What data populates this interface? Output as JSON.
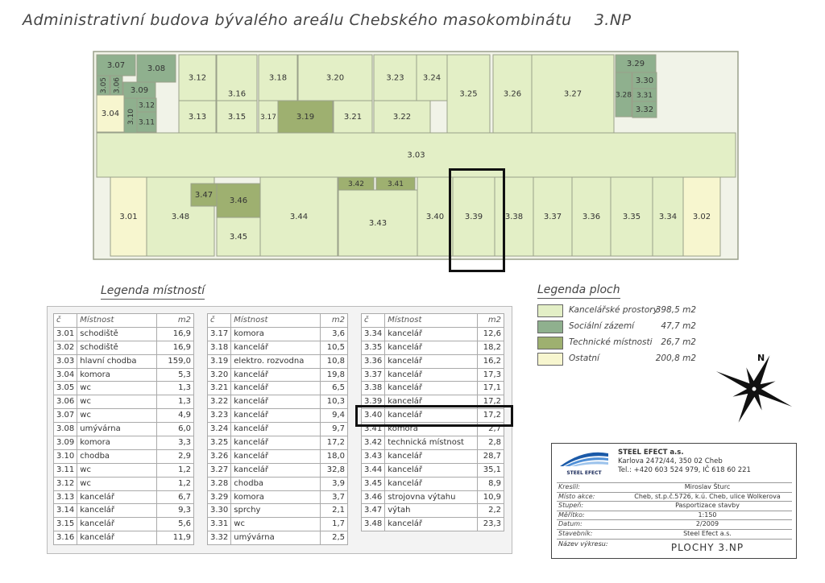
{
  "title": {
    "text": "Administrativní budova bývalého areálu Chebského masokombinátu",
    "floor": "3.NP"
  },
  "colors": {
    "office": "#e3efc6",
    "social": "#8fb08e",
    "technical": "#9eb070",
    "other": "#f7f6cf",
    "wall": "#8a8a8a",
    "outline": "#aab28a"
  },
  "rooms": [
    {
      "id": "3.07",
      "type": "social"
    },
    {
      "id": "3.08",
      "type": "social"
    },
    {
      "id": "3.05",
      "type": "social"
    },
    {
      "id": "3.06",
      "type": "social"
    },
    {
      "id": "3.09",
      "type": "social"
    },
    {
      "id": "3.04",
      "type": "other"
    },
    {
      "id": "3.10",
      "type": "social"
    },
    {
      "id": "3.12",
      "type": "social"
    },
    {
      "id": "3.11",
      "type": "social"
    },
    {
      "id": "3.12",
      "type": "office"
    },
    {
      "id": "3.13",
      "type": "office"
    },
    {
      "id": "3.16",
      "type": "office"
    },
    {
      "id": "3.15",
      "type": "office"
    },
    {
      "id": "3.18",
      "type": "office"
    },
    {
      "id": "3.17",
      "type": "office"
    },
    {
      "id": "3.19",
      "type": "technical"
    },
    {
      "id": "3.20",
      "type": "office"
    },
    {
      "id": "3.21",
      "type": "office"
    },
    {
      "id": "3.23",
      "type": "office"
    },
    {
      "id": "3.22",
      "type": "office"
    },
    {
      "id": "3.24",
      "type": "office"
    },
    {
      "id": "3.25",
      "type": "office"
    },
    {
      "id": "3.26",
      "type": "office"
    },
    {
      "id": "3.27",
      "type": "office"
    },
    {
      "id": "3.29",
      "type": "social"
    },
    {
      "id": "3.28",
      "type": "social"
    },
    {
      "id": "3.30",
      "type": "social"
    },
    {
      "id": "3.31",
      "type": "social"
    },
    {
      "id": "3.32",
      "type": "social"
    },
    {
      "id": "3.03",
      "type": "office"
    },
    {
      "id": "3.01",
      "type": "other"
    },
    {
      "id": "3.48",
      "type": "office"
    },
    {
      "id": "3.47",
      "type": "technical"
    },
    {
      "id": "3.46",
      "type": "technical"
    },
    {
      "id": "3.45",
      "type": "office"
    },
    {
      "id": "3.44",
      "type": "office"
    },
    {
      "id": "3.42",
      "type": "technical"
    },
    {
      "id": "3.41",
      "type": "technical"
    },
    {
      "id": "3.43",
      "type": "office"
    },
    {
      "id": "3.40",
      "type": "office"
    },
    {
      "id": "3.39",
      "type": "office"
    },
    {
      "id": "3.38",
      "type": "office"
    },
    {
      "id": "3.37",
      "type": "office"
    },
    {
      "id": "3.36",
      "type": "office"
    },
    {
      "id": "3.35",
      "type": "office"
    },
    {
      "id": "3.34",
      "type": "office"
    },
    {
      "id": "3.02",
      "type": "other"
    }
  ],
  "legend_rooms": {
    "title": "Legenda místností",
    "headers": [
      "č",
      "Místnost",
      "m2"
    ],
    "col1": [
      [
        "3.01",
        "schodiště",
        "16,9"
      ],
      [
        "3.02",
        "schodiště",
        "16,9"
      ],
      [
        "3.03",
        "hlavní chodba",
        "159,0"
      ],
      [
        "3.04",
        "komora",
        "5,3"
      ],
      [
        "3.05",
        "wc",
        "1,3"
      ],
      [
        "3.06",
        "wc",
        "1,3"
      ],
      [
        "3.07",
        "wc",
        "4,9"
      ],
      [
        "3.08",
        "umývárna",
        "6,0"
      ],
      [
        "3.09",
        "komora",
        "3,3"
      ],
      [
        "3.10",
        "chodba",
        "2,9"
      ],
      [
        "3.11",
        "wc",
        "1,2"
      ],
      [
        "3.12",
        "wc",
        "1,2"
      ],
      [
        "3.13",
        "kancelář",
        "6,7"
      ],
      [
        "3.14",
        "kancelář",
        "9,3"
      ],
      [
        "3.15",
        "kancelář",
        "5,6"
      ],
      [
        "3.16",
        "kancelář",
        "11,9"
      ]
    ],
    "col2": [
      [
        "3.17",
        "komora",
        "3,6"
      ],
      [
        "3.18",
        "kancelář",
        "10,5"
      ],
      [
        "3.19",
        "elektro. rozvodna",
        "10,8"
      ],
      [
        "3.20",
        "kancelář",
        "19,8"
      ],
      [
        "3.21",
        "kancelář",
        "6,5"
      ],
      [
        "3.22",
        "kancelář",
        "10,3"
      ],
      [
        "3.23",
        "kancelář",
        "9,4"
      ],
      [
        "3.24",
        "kancelář",
        "9,7"
      ],
      [
        "3.25",
        "kancelář",
        "17,2"
      ],
      [
        "3.26",
        "kancelář",
        "18,0"
      ],
      [
        "3.27",
        "kancelář",
        "32,8"
      ],
      [
        "3.28",
        "chodba",
        "3,9"
      ],
      [
        "3.29",
        "komora",
        "3,7"
      ],
      [
        "3.30",
        "sprchy",
        "2,1"
      ],
      [
        "3.31",
        "wc",
        "1,7"
      ],
      [
        "3.32",
        "umývárna",
        "2,5"
      ]
    ],
    "col3": [
      [
        "",
        "",
        " "
      ],
      [
        "3.34",
        "kancelář",
        "12,6"
      ],
      [
        "3.35",
        "kancelář",
        "18,2"
      ],
      [
        "3.36",
        "kancelář",
        "16,2"
      ],
      [
        "3.37",
        "kancelář",
        "17,3"
      ],
      [
        "3.38",
        "kancelář",
        "17,1"
      ],
      [
        "3.39",
        "kancelář",
        "17,2"
      ],
      [
        "3.40",
        "kancelář",
        "17,2"
      ],
      [
        "3.41",
        "komora",
        "2,7"
      ],
      [
        "3.42",
        "technická místnost",
        "2,8"
      ],
      [
        "3.43",
        "kancelář",
        "28,7"
      ],
      [
        "3.44",
        "kancelář",
        "35,1"
      ],
      [
        "3.45",
        "kancelář",
        "8,9"
      ],
      [
        "3.46",
        "strojovna výtahu",
        "10,9"
      ],
      [
        "3.47",
        "výtah",
        "2,2"
      ],
      [
        "3.48",
        "kancelář",
        "23,3"
      ]
    ]
  },
  "legend_areas": {
    "title": "Legenda ploch",
    "items": [
      {
        "label": "Kancelářské prostory",
        "value": "398,5 m2",
        "color": "#e3efc6"
      },
      {
        "label": "Sociální zázemí",
        "value": "47,7 m2",
        "color": "#8fb08e"
      },
      {
        "label": "Technické místnosti",
        "value": "26,7 m2",
        "color": "#9eb070"
      },
      {
        "label": "Ostatní",
        "value": "200,8 m2",
        "color": "#f7f6cf"
      }
    ]
  },
  "compass": {
    "label": "N"
  },
  "stamp": {
    "logo_text": "STEEL EFECT",
    "company": "STEEL EFECT a.s.",
    "address": "Karlova 2472/44, 350 02 Cheb",
    "contact": "Tel.: +420 603 524 979, IČ 618 60 221",
    "rows": [
      {
        "k": "Kreslil:",
        "v": "Miroslav Šturc"
      },
      {
        "k": "Místo akce:",
        "v": "Cheb, st.p.č.5726, k.ú. Cheb, ulice Wolkerova"
      },
      {
        "k": "Stupeň:",
        "v": "Pasportizace stavby"
      },
      {
        "k": "Měřítko:",
        "v": "1:150"
      },
      {
        "k": "Datum:",
        "v": "2/2009"
      },
      {
        "k": "Stavebník:",
        "v": "Steel Efect a.s."
      }
    ],
    "drawing_label": "Název výkresu:",
    "drawing_name": "PLOCHY 3.NP"
  }
}
